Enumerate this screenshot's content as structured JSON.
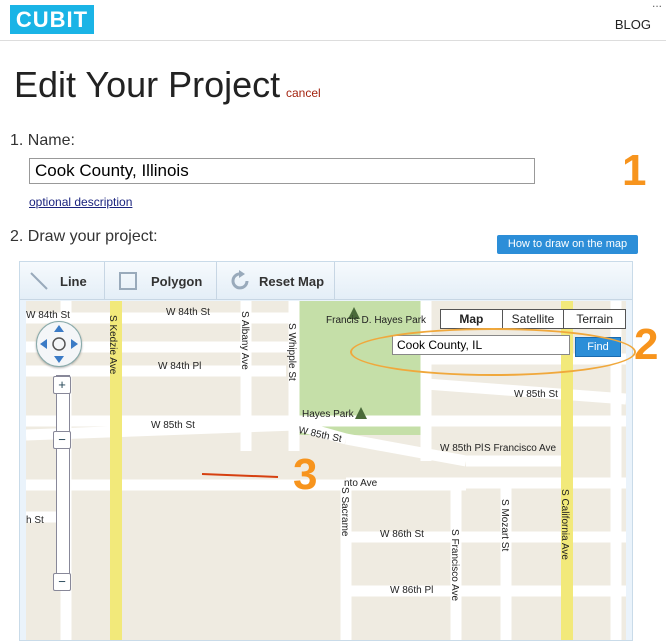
{
  "header": {
    "logo": "CUBIT",
    "blog": "BLOG",
    "dots": "..."
  },
  "page": {
    "title": "Edit Your Project",
    "cancel": "cancel"
  },
  "step1": {
    "label": "1. Name:",
    "name_value": "Cook County, Illinois",
    "optional": "optional description"
  },
  "step2": {
    "label": "2. Draw your project:",
    "howto": "How to draw on the map"
  },
  "toolbar": {
    "line": "Line",
    "polygon": "Polygon",
    "reset": "Reset Map"
  },
  "map": {
    "types": [
      "Map",
      "Satellite",
      "Terrain"
    ],
    "search_value": "Cook County, IL",
    "find": "Find",
    "labels": {
      "w84st_a": "W 84th St",
      "w84th_st_left": "W 84th St",
      "w84pl": "W 84th Pl",
      "w85st_left": "W 85th St",
      "w85st_mid": "W 85th St",
      "w85st_right": "W 85th St",
      "w85pl": "W 85th Pl",
      "sfrancisco_ave": "S Francisco Ave",
      "nto_ave": "nto Ave",
      "w86st": "W 86th St",
      "w86pl": "W 86th Pl",
      "h_st": "h St",
      "kedzie": "S Kedzie Ave",
      "albany": "S Albany Ave",
      "whipple": "S Whipple St",
      "sacramento": "S Sacrame",
      "francisco_v": "S Francisco Ave",
      "mozart": "S Mozart St",
      "california": "S California Ave",
      "park_name": "Francis D. Hayes Park",
      "hayes_park": "Hayes Park"
    }
  },
  "annotations": {
    "one": "1",
    "two": "2",
    "three": "3"
  },
  "colors": {
    "accent": "#1ab4e6",
    "button": "#2c8ed8",
    "annotation": "#f7941d",
    "cancel": "#a32410"
  }
}
